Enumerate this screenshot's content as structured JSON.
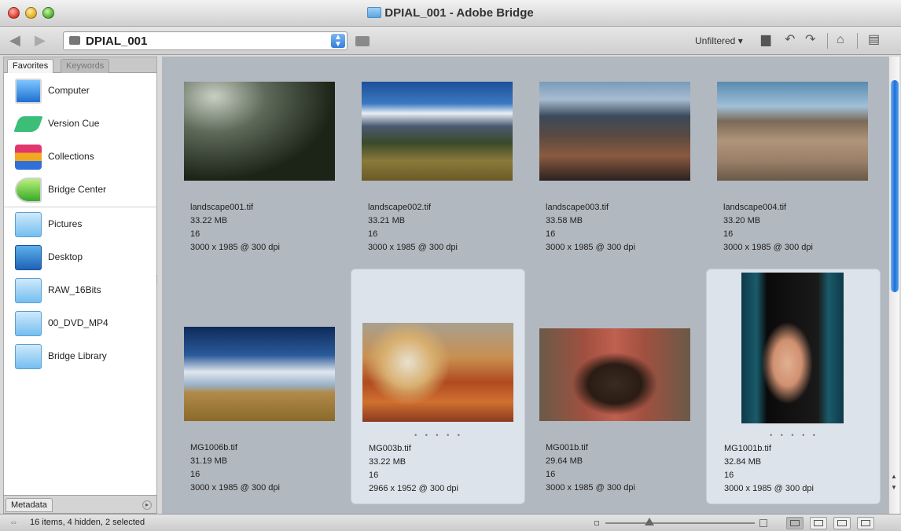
{
  "window": {
    "title": "DPIAL_001 - Adobe Bridge"
  },
  "toolbar": {
    "back_icon": "back-arrow-icon",
    "forward_icon": "forward-arrow-icon",
    "path_label": "DPIAL_001",
    "filter_label": "Unfiltered ▾"
  },
  "sidebar": {
    "tabs": [
      "Favorites",
      "Keywords"
    ],
    "items": [
      {
        "label": "Computer",
        "icon": "computer-icon"
      },
      {
        "label": "Version Cue",
        "icon": "version-cue-icon"
      },
      {
        "label": "Collections",
        "icon": "collections-icon"
      },
      {
        "label": "Bridge Center",
        "icon": "bridge-center-icon"
      },
      {
        "label": "Pictures",
        "icon": "pictures-folder-icon"
      },
      {
        "label": "Desktop",
        "icon": "desktop-icon"
      },
      {
        "label": "RAW_16Bits",
        "icon": "folder-icon"
      },
      {
        "label": "00_DVD_MP4",
        "icon": "folder-icon"
      },
      {
        "label": "Bridge Library",
        "icon": "folder-icon"
      }
    ],
    "metadata_tab": "Metadata"
  },
  "thumbnails": [
    {
      "name": "landscape001.tif",
      "size": "33.22 MB",
      "depth": "16",
      "dims": "3000 x 1985 @ 300 dpi",
      "stars": "",
      "selected": false
    },
    {
      "name": "landscape002.tif",
      "size": "33.21 MB",
      "depth": "16",
      "dims": "3000 x 1985 @ 300 dpi",
      "stars": "",
      "selected": false
    },
    {
      "name": "landscape003.tif",
      "size": "33.58 MB",
      "depth": "16",
      "dims": "3000 x 1985 @ 300 dpi",
      "stars": "",
      "selected": false
    },
    {
      "name": "landscape004.tif",
      "size": "33.20 MB",
      "depth": "16",
      "dims": "3000 x 1985 @ 300 dpi",
      "stars": "",
      "selected": false
    },
    {
      "name": "MG1006b.tif",
      "size": "31.19 MB",
      "depth": "16",
      "dims": "3000 x 1985 @ 300 dpi",
      "stars": "",
      "selected": false
    },
    {
      "name": "MG003b.tif",
      "size": "33.22 MB",
      "depth": "16",
      "dims": "2966 x 1952 @ 300 dpi",
      "stars": "• • • • •",
      "selected": true
    },
    {
      "name": "MG001b.tif",
      "size": "29.64 MB",
      "depth": "16",
      "dims": "3000 x 1985 @ 300 dpi",
      "stars": "",
      "selected": false
    },
    {
      "name": "MG1001b.tif",
      "size": "32.84 MB",
      "depth": "16",
      "dims": "3000 x 1985 @ 300 dpi",
      "stars": "• • • • •",
      "selected": true
    }
  ],
  "statusbar": {
    "text": "16 items, 4 hidden, 2 selected"
  },
  "colors": {
    "content_bg": "#b2b8bf",
    "selection_bg": "#dde3ea",
    "scroll_accent": "#1c6fd6"
  }
}
